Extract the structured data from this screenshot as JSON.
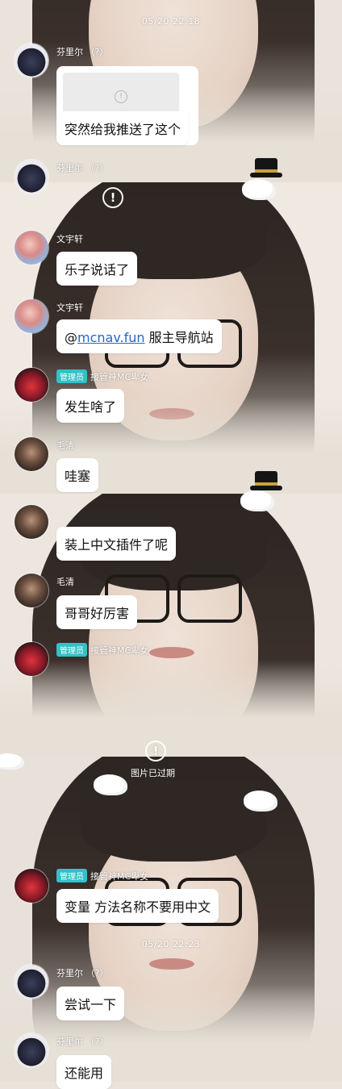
{
  "timestamps": {
    "first": "05/20 22:18",
    "second": "05/20 22:23"
  },
  "image_placeholder_icon": "info-circle-icon",
  "messages": [
    {
      "sender": "芬里尔 （?）",
      "text": "突然给我推送了这个"
    },
    {
      "sender": "芬里尔 （?）"
    },
    {
      "sender": "文宇轩",
      "text": "乐子说话了"
    },
    {
      "sender": "文宇轩",
      "text_prefix": "@",
      "mention": "mcnav.fun",
      "text_suffix": " 服主导航站"
    },
    {
      "badge": "管理员",
      "sender": "接管神MC卑女",
      "text": "发生啥了"
    },
    {
      "sender": "毛清",
      "text": "哇塞"
    },
    {
      "text": "装上中文插件了呢"
    },
    {
      "sender": "毛清",
      "text": "哥哥好厉害"
    },
    {
      "badge": "管理员",
      "sender": "接管神MC卑女"
    },
    {
      "badge": "管理员",
      "sender": "接管神MC卑女",
      "text": "变量 方法名称不要用中文"
    },
    {
      "sender": "芬里尔 （?）",
      "text": "尝试一下"
    },
    {
      "sender": "芬里尔 （?）",
      "text": "还能用"
    }
  ],
  "notices": {
    "recalled": "图片已过期"
  },
  "colors": {
    "badge": "#2fc3c8",
    "mention": "#2b62c9",
    "bubble": "#ffffff"
  }
}
